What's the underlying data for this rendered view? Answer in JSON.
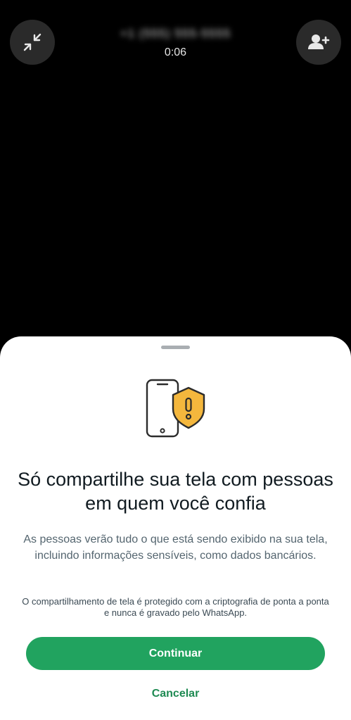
{
  "call": {
    "caller_number": "+1 (555) 555-5555",
    "timer": "0:06"
  },
  "icons": {
    "minimize": "minimize-icon",
    "add_person": "add-person-icon",
    "phone_shield": "phone-shield-warning-icon"
  },
  "sheet": {
    "title": "Só compartilhe sua tela com pessoas em quem você confia",
    "body": "As pessoas verão tudo o que está sendo exibido na sua tela, incluindo informações sensíveis, como dados bancários.",
    "note": "O compartilhamento de tela é protegido com a criptografia de ponta a ponta e nunca é gravado pelo WhatsApp.",
    "continue_label": "Continuar",
    "cancel_label": "Cancelar"
  },
  "colors": {
    "accent": "#21a35f",
    "link": "#1e8a52",
    "shield": "#f4b73d"
  }
}
